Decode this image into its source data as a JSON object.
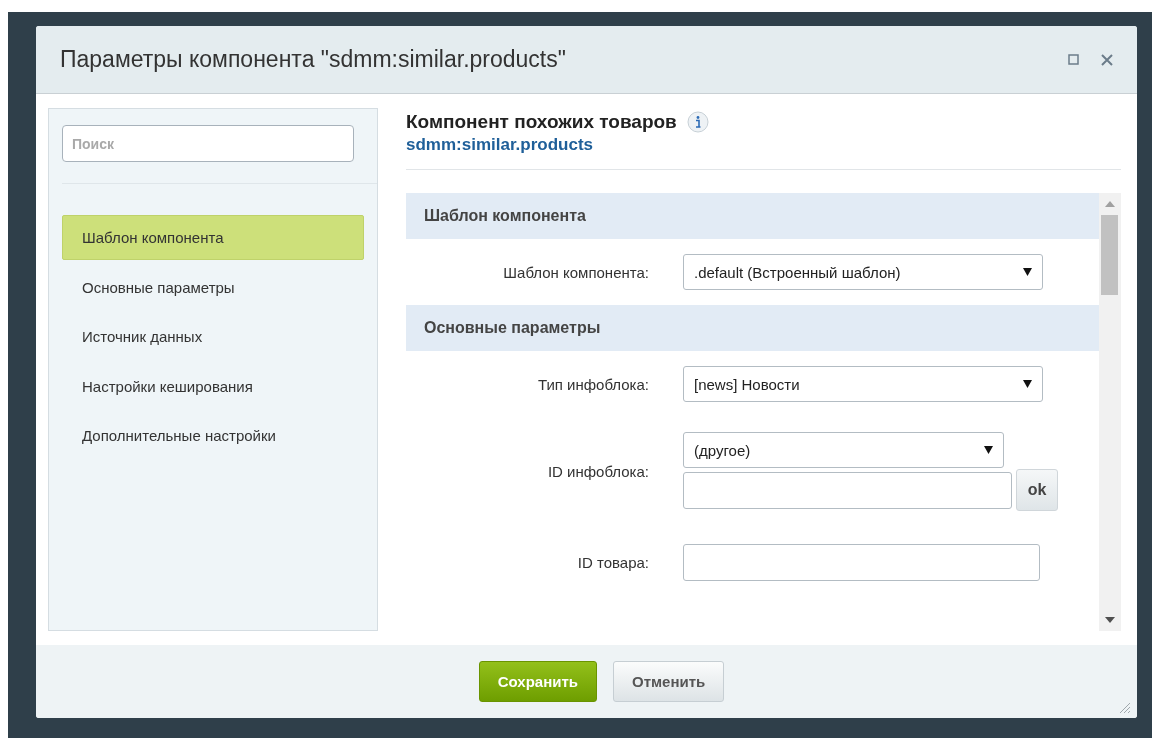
{
  "window": {
    "title": "Параметры компонента \"sdmm:similar.products\""
  },
  "sidebar": {
    "search": {
      "placeholder": "Поиск"
    },
    "items": [
      {
        "label": "Шаблон компонента",
        "selected": true
      },
      {
        "label": "Основные параметры",
        "selected": false
      },
      {
        "label": "Источник данных",
        "selected": false
      },
      {
        "label": "Настройки кеширования",
        "selected": false
      },
      {
        "label": "Дополнительные настройки",
        "selected": false
      }
    ]
  },
  "component": {
    "title": "Компонент похожих товаров",
    "code": "sdmm:similar.products"
  },
  "form": [
    {
      "kind": "section",
      "label": "Шаблон компонента"
    },
    {
      "kind": "select",
      "label": "Шаблон компонента:",
      "value": ".default (Встроенный шаблон)"
    },
    {
      "kind": "section",
      "label": "Основные параметры"
    },
    {
      "kind": "select",
      "label": "Тип инфоблока:",
      "value": "[news] Новости"
    },
    {
      "kind": "select-input",
      "label": "ID инфоблока:",
      "value": "(другое)",
      "button": "ok"
    },
    {
      "kind": "input",
      "label": "ID товара:"
    }
  ],
  "buttons": [
    {
      "label": "Сохранить",
      "kind": "primary"
    },
    {
      "label": "Отменить",
      "kind": "secondary"
    }
  ]
}
